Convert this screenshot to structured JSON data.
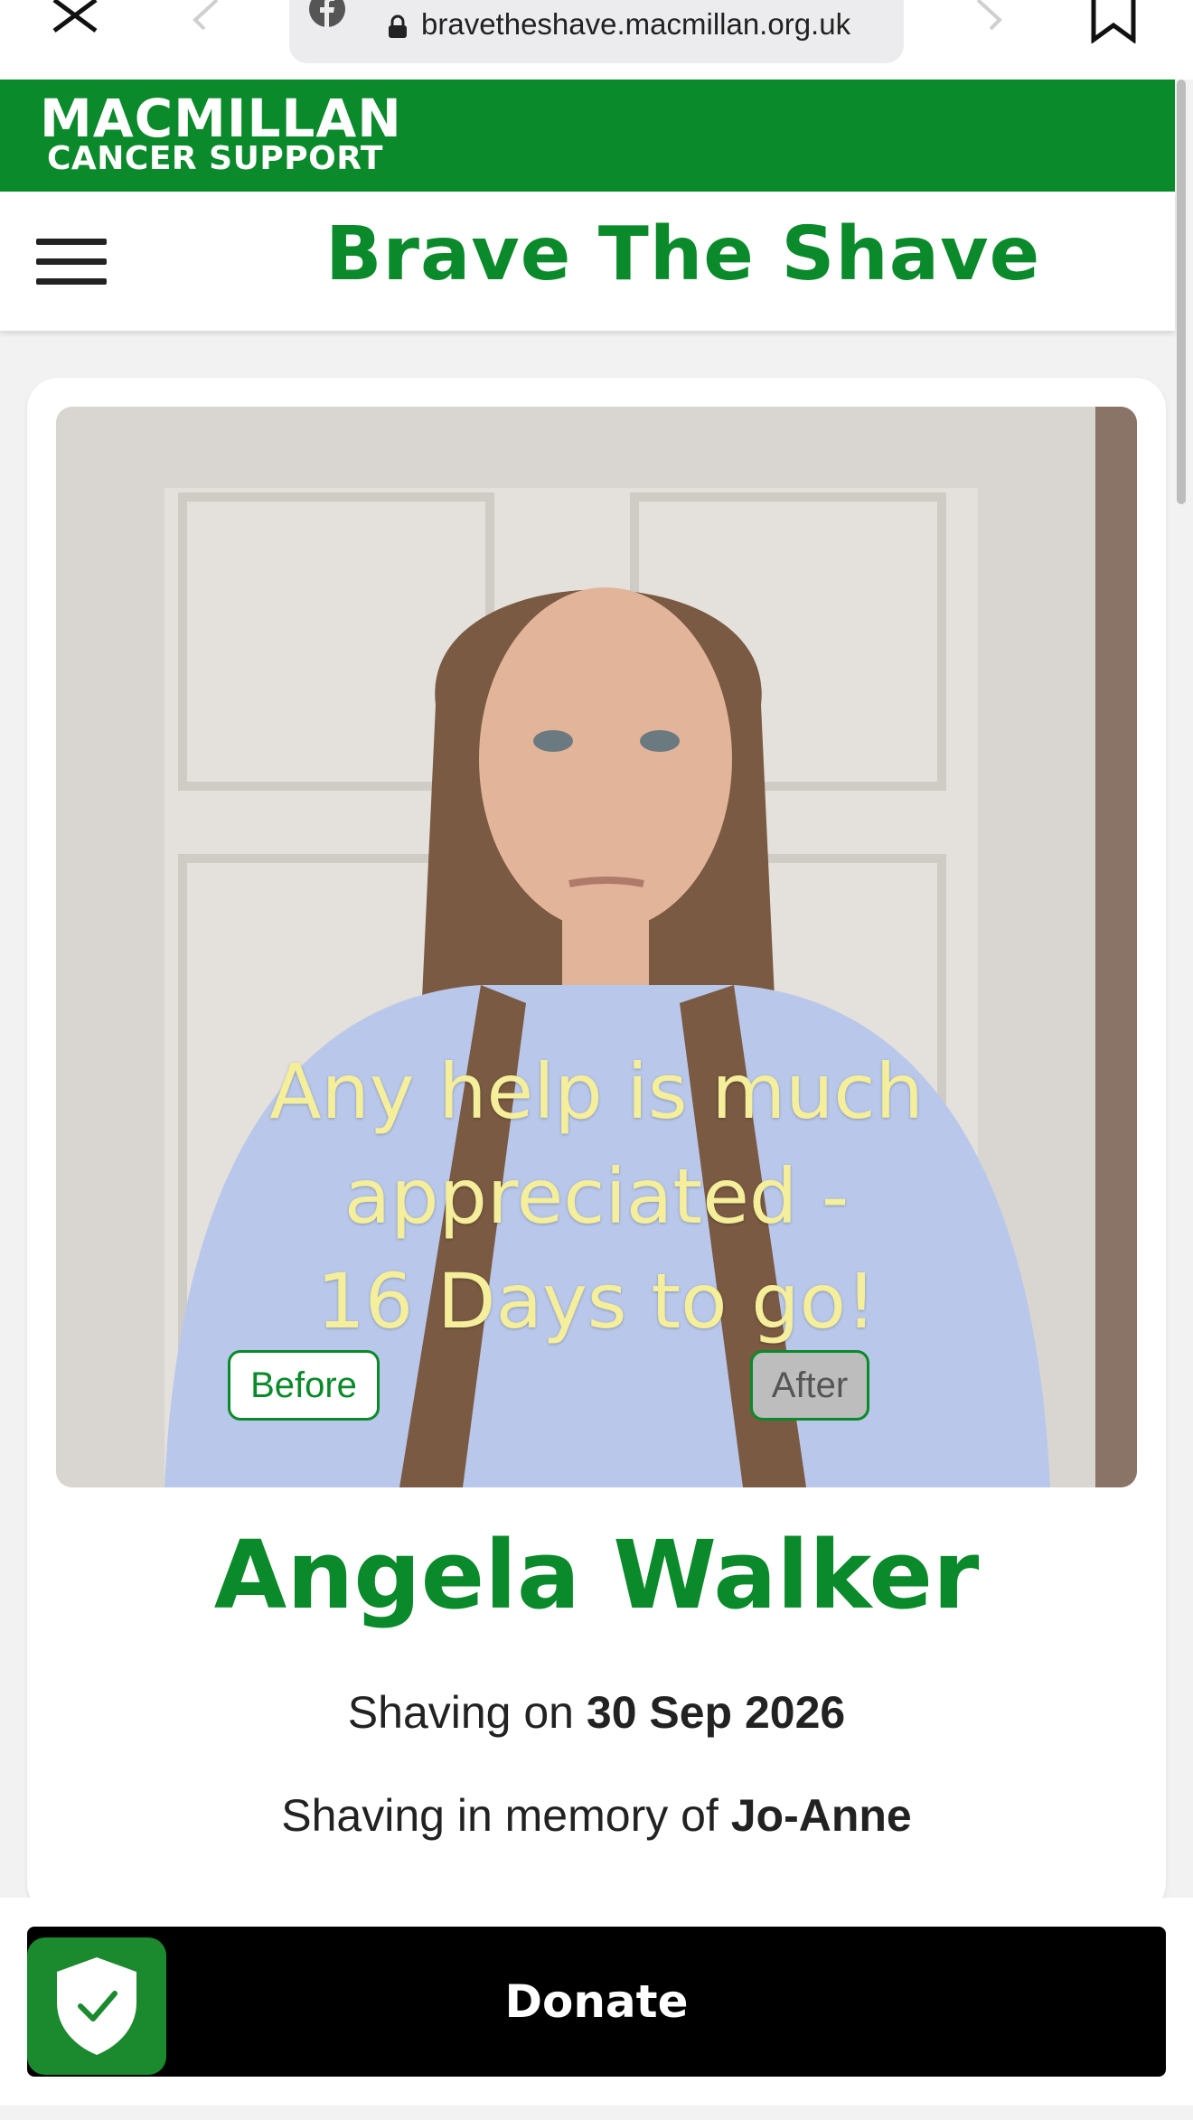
{
  "browser": {
    "url": "bravetheshave.macmillan.org.uk"
  },
  "header": {
    "logo_line1": "MACMILLAN",
    "logo_line2": "CANCER SUPPORT",
    "title": "Brave The Shave"
  },
  "profile": {
    "overlay_lines": [
      "Any help is much",
      "appreciated -",
      "16 Days to go!"
    ],
    "before_label": "Before",
    "after_label": "After",
    "name": "Angela Walker",
    "shaving_on_prefix": "Shaving on",
    "shaving_date": "30 Sep 2026",
    "memory_prefix": "Shaving in memory of",
    "memory_name": "Jo-Anne"
  },
  "actions": {
    "donate_label": "Donate"
  },
  "colors": {
    "brand_green": "#0a8a2a",
    "overlay_text": "#f5ee9a"
  },
  "icons": [
    "close-icon",
    "back-icon",
    "forward-icon",
    "bookmark-icon",
    "facebook-icon",
    "lock-icon",
    "menu-icon",
    "shield-check-icon"
  ]
}
